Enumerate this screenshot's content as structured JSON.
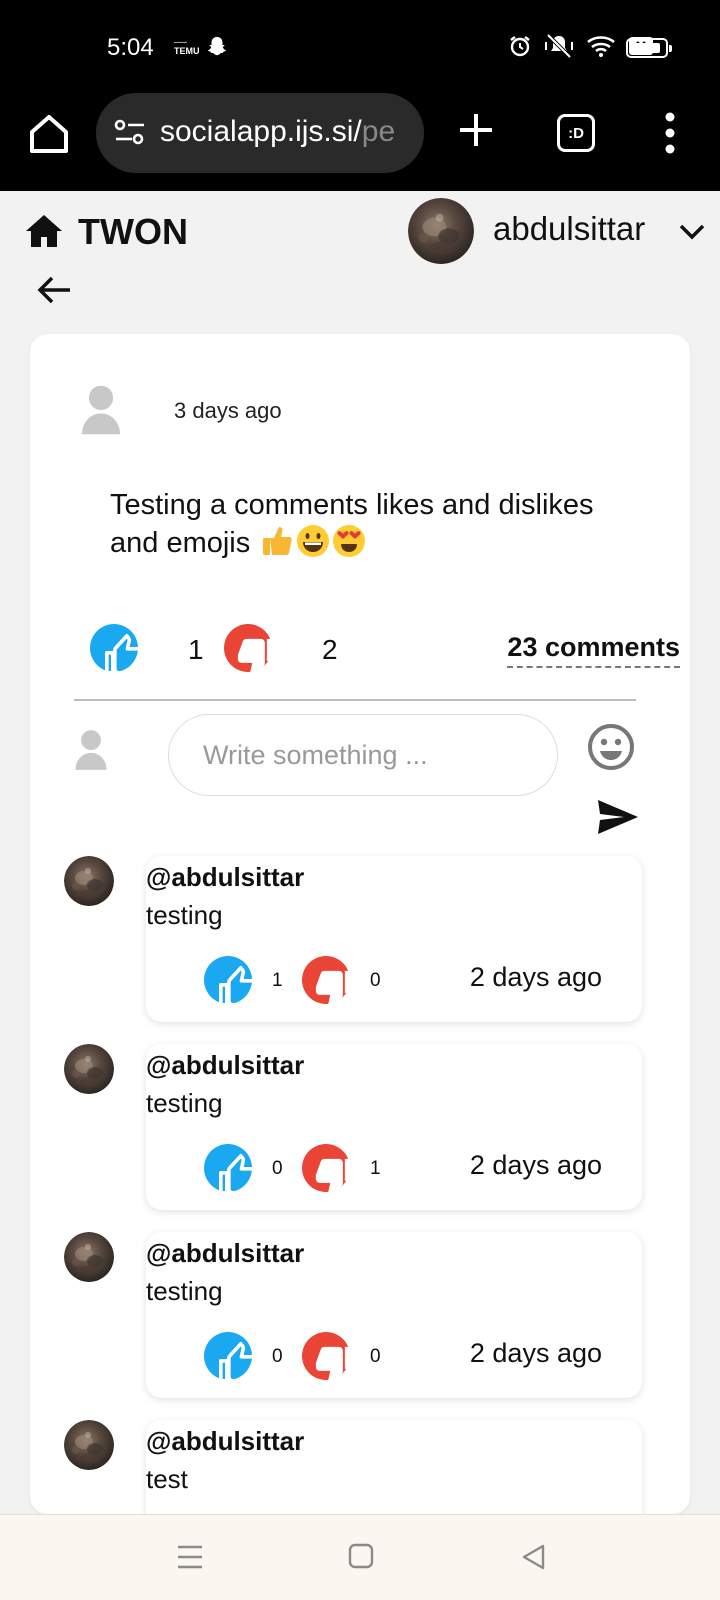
{
  "status_bar": {
    "time": "5:04",
    "temu_label": "TEMU",
    "battery_level": 0.85
  },
  "browser": {
    "url_main": "socialapp.ijs.si/",
    "url_faded": "pe",
    "tabs_label": ":D"
  },
  "app": {
    "brand": "TWON",
    "username": "abdulsittar"
  },
  "post": {
    "time": "3 days ago",
    "text": "Testing a comments likes and dislikes and emojis",
    "emojis": [
      "thumbs-up-emoji",
      "grinning-face-emoji",
      "heart-eyes-emoji"
    ],
    "likes": "1",
    "dislikes": "2",
    "comments_label": "23 comments"
  },
  "composer": {
    "placeholder": "Write something ..."
  },
  "comments": [
    {
      "user": "@abdulsittar",
      "text": "testing",
      "likes": "1",
      "dislikes": "0",
      "time": "2 days ago"
    },
    {
      "user": "@abdulsittar",
      "text": "testing",
      "likes": "0",
      "dislikes": "1",
      "time": "2 days ago"
    },
    {
      "user": "@abdulsittar",
      "text": "testing",
      "likes": "0",
      "dislikes": "0",
      "time": "2 days ago"
    },
    {
      "user": "@abdulsittar",
      "text": "test"
    }
  ],
  "colors": {
    "like": "#1aa9f0",
    "dislike": "#ea4436",
    "background": "#f2f2f2"
  }
}
